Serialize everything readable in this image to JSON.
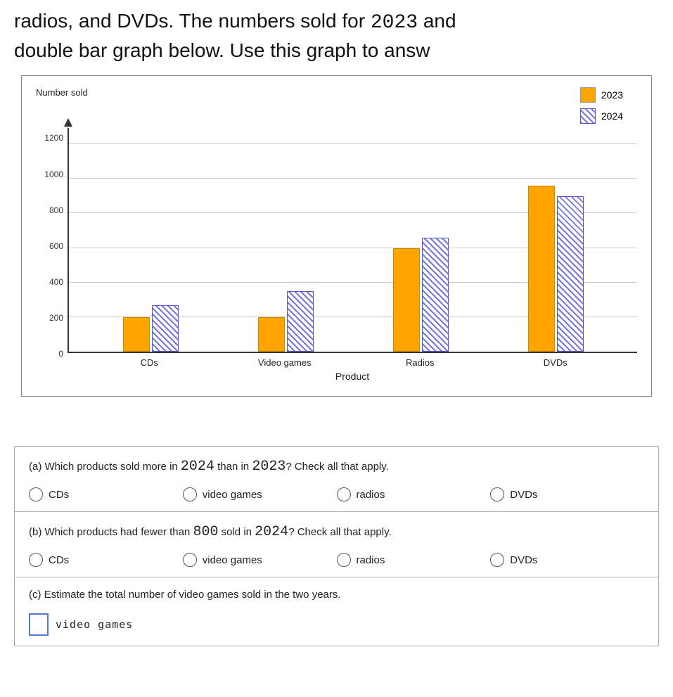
{
  "top_text": {
    "line1": "radios, and DVDs. The numbers sold for",
    "year_highlight": "2023",
    "line1_end": "and",
    "line2": "double bar graph below. Use this graph to answ"
  },
  "chart": {
    "y_label": "Number sold",
    "x_label": "Product",
    "legend": {
      "year2023_label": "2023",
      "year2024_label": "2024"
    },
    "y_ticks": [
      "0",
      "200",
      "400",
      "600",
      "800",
      "1000",
      "1200"
    ],
    "products": [
      "CDs",
      "Video games",
      "Radios",
      "DVDs"
    ],
    "data_2023": [
      200,
      200,
      600,
      960
    ],
    "data_2024": [
      270,
      350,
      660,
      900
    ]
  },
  "questions": {
    "a": {
      "text_before": "Which products sold more in",
      "year1": "2024",
      "text_middle": "than in",
      "year2": "2023",
      "text_end": "? Check all that apply.",
      "options": [
        "CDs",
        "video games",
        "radios",
        "DVDs"
      ]
    },
    "b": {
      "text_before": "Which products had fewer than",
      "number": "800",
      "text_middle": "sold in",
      "year": "2024",
      "text_end": "? Check all that apply.",
      "options": [
        "CDs",
        "video games",
        "radios",
        "DVDs"
      ]
    },
    "c": {
      "text": "Estimate the total number of video games sold in the two years.",
      "answer_label": "video games"
    }
  }
}
